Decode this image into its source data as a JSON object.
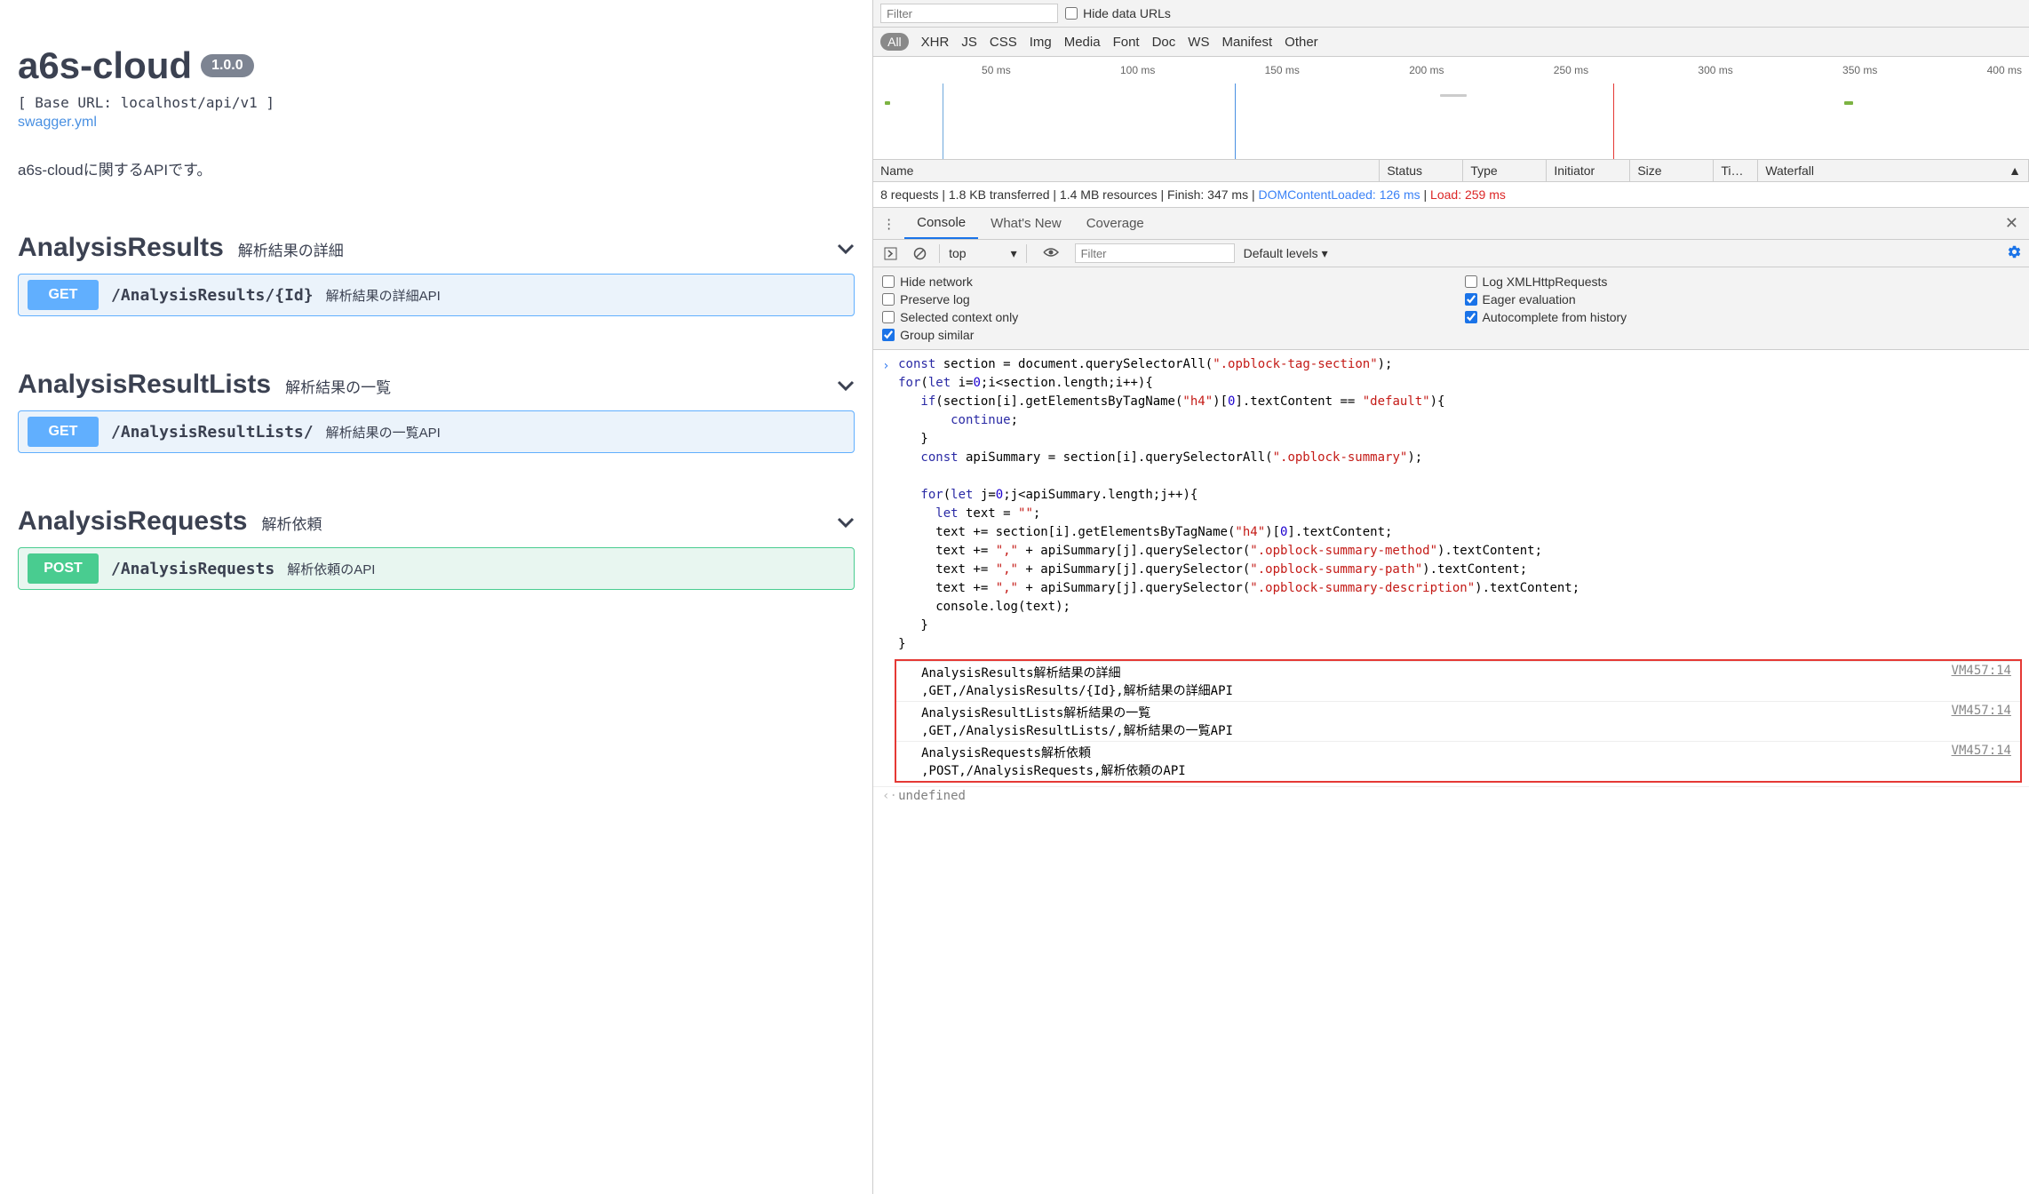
{
  "swagger": {
    "title": "a6s-cloud",
    "version": "1.0.0",
    "baseUrl": "[ Base URL: localhost/api/v1 ]",
    "defLink": "swagger.yml",
    "description": "a6s-cloudに関するAPIです。",
    "tags": [
      {
        "name": "AnalysisResults",
        "desc": "解析結果の詳細",
        "ops": [
          {
            "method": "GET",
            "methodClass": "get",
            "path": "/AnalysisResults/{Id}",
            "desc": "解析結果の詳細API"
          }
        ]
      },
      {
        "name": "AnalysisResultLists",
        "desc": "解析結果の一覧",
        "ops": [
          {
            "method": "GET",
            "methodClass": "get",
            "path": "/AnalysisResultLists/",
            "desc": "解析結果の一覧API"
          }
        ]
      },
      {
        "name": "AnalysisRequests",
        "desc": "解析依頼",
        "ops": [
          {
            "method": "POST",
            "methodClass": "post",
            "path": "/AnalysisRequests",
            "desc": "解析依頼のAPI"
          }
        ]
      }
    ]
  },
  "devtools": {
    "filterPlaceholder": "Filter",
    "hideDataUrls": "Hide data URLs",
    "types": {
      "all": "All",
      "xhr": "XHR",
      "js": "JS",
      "css": "CSS",
      "img": "Img",
      "media": "Media",
      "font": "Font",
      "doc": "Doc",
      "ws": "WS",
      "manifest": "Manifest",
      "other": "Other"
    },
    "ticks": [
      "50 ms",
      "100 ms",
      "150 ms",
      "200 ms",
      "250 ms",
      "300 ms",
      "350 ms",
      "400 ms"
    ],
    "cols": {
      "name": "Name",
      "status": "Status",
      "type": "Type",
      "initiator": "Initiator",
      "size": "Size",
      "time": "Ti…",
      "waterfall": "Waterfall"
    },
    "summaryPrefix": "8 requests | 1.8 KB transferred | 1.4 MB resources | Finish: 347 ms | ",
    "domc": "DOMContentLoaded: 126 ms",
    "summarySep": " | ",
    "load": "Load: 259 ms",
    "drawerTabs": {
      "console": "Console",
      "whatsnew": "What's New",
      "coverage": "Coverage"
    },
    "consoleBar": {
      "context": "top",
      "filterPlaceholder": "Filter",
      "levels": "Default levels"
    },
    "settings": {
      "hideNetwork": "Hide network",
      "preserveLog": "Preserve log",
      "selectedCtx": "Selected context only",
      "groupSimilar": "Group similar",
      "logXhr": "Log XMLHttpRequests",
      "eager": "Eager evaluation",
      "autocomplete": "Autocomplete from history"
    },
    "logs": [
      {
        "text": "AnalysisResults解析結果の詳細\n,GET,/AnalysisResults/{Id},解析結果の詳細API",
        "loc": "VM457:14"
      },
      {
        "text": "AnalysisResultLists解析結果の一覧\n,GET,/AnalysisResultLists/,解析結果の一覧API",
        "loc": "VM457:14"
      },
      {
        "text": "AnalysisRequests解析依頼\n,POST,/AnalysisRequests,解析依頼のAPI",
        "loc": "VM457:14"
      }
    ],
    "undefined": "undefined"
  }
}
